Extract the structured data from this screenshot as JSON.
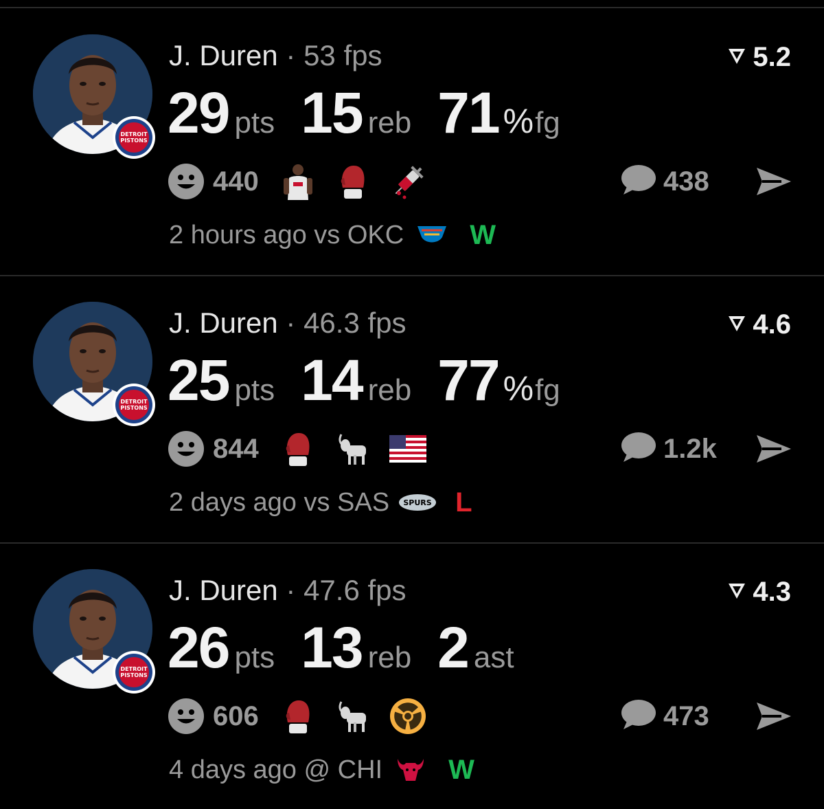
{
  "cards": [
    {
      "player": "J. Duren",
      "separator": "·",
      "fps": "53 fps",
      "rating": "5.2",
      "stats": [
        {
          "value": "29",
          "unit": "pts"
        },
        {
          "value": "15",
          "unit": "reb"
        },
        {
          "value": "71",
          "pct": "%",
          "unit": "fg"
        }
      ],
      "reactions_count": "440",
      "reaction_icons": [
        "player-card-icon",
        "boxing-glove-icon",
        "syringe-icon"
      ],
      "comments_count": "438",
      "time_ago": "2 hours ago",
      "venue": "vs",
      "opponent": "OKC",
      "result": "W",
      "result_color": "#1db954"
    },
    {
      "player": "J. Duren",
      "separator": "·",
      "fps": "46.3 fps",
      "rating": "4.6",
      "stats": [
        {
          "value": "25",
          "unit": "pts"
        },
        {
          "value": "14",
          "unit": "reb"
        },
        {
          "value": "77",
          "pct": "%",
          "unit": "fg"
        }
      ],
      "reactions_count": "844",
      "reaction_icons": [
        "boxing-glove-icon",
        "goat-icon",
        "us-flag-icon"
      ],
      "comments_count": "1.2k",
      "time_ago": "2 days ago",
      "venue": "vs",
      "opponent": "SAS",
      "result": "L",
      "result_color": "#e0242c"
    },
    {
      "player": "J. Duren",
      "separator": "·",
      "fps": "47.6 fps",
      "rating": "4.3",
      "stats": [
        {
          "value": "26",
          "unit": "pts"
        },
        {
          "value": "13",
          "unit": "reb"
        },
        {
          "value": "2",
          "unit": "ast"
        }
      ],
      "reactions_count": "606",
      "reaction_icons": [
        "boxing-glove-icon",
        "goat-icon",
        "radioactive-icon"
      ],
      "comments_count": "473",
      "time_ago": "4 days ago",
      "venue": "@",
      "opponent": "CHI",
      "result": "W",
      "result_color": "#1db954"
    }
  ],
  "team_badge_text": [
    "DETROIT",
    "PISTONS"
  ],
  "colors": {
    "background": "#000000",
    "divider": "#2a2a2a",
    "primary_text": "#f2f2f2",
    "secondary_text": "#9a9a9a",
    "win": "#1db954",
    "loss": "#e0242c"
  }
}
